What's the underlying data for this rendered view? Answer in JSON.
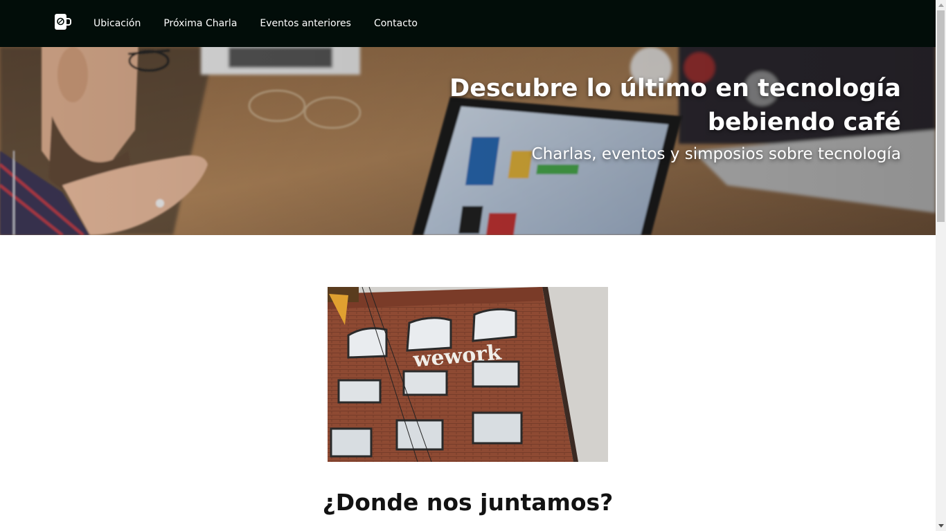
{
  "navbar": {
    "logo_icon": "coffee-cup-icon",
    "links": [
      {
        "label": "Ubicación"
      },
      {
        "label": "Próxima Charla"
      },
      {
        "label": "Eventos anteriores"
      },
      {
        "label": "Contacto"
      }
    ]
  },
  "hero": {
    "title_line1": "Descubre lo último en tecnología",
    "title_line2": "bebiendo café",
    "subtitle": "Charlas, eventos y simposios sobre tecnología"
  },
  "location": {
    "image_sign_text": "wework",
    "heading": "¿Donde nos juntamos?"
  },
  "colors": {
    "navbar_bg": "#020d09",
    "text_dark": "#121212",
    "white": "#ffffff"
  }
}
